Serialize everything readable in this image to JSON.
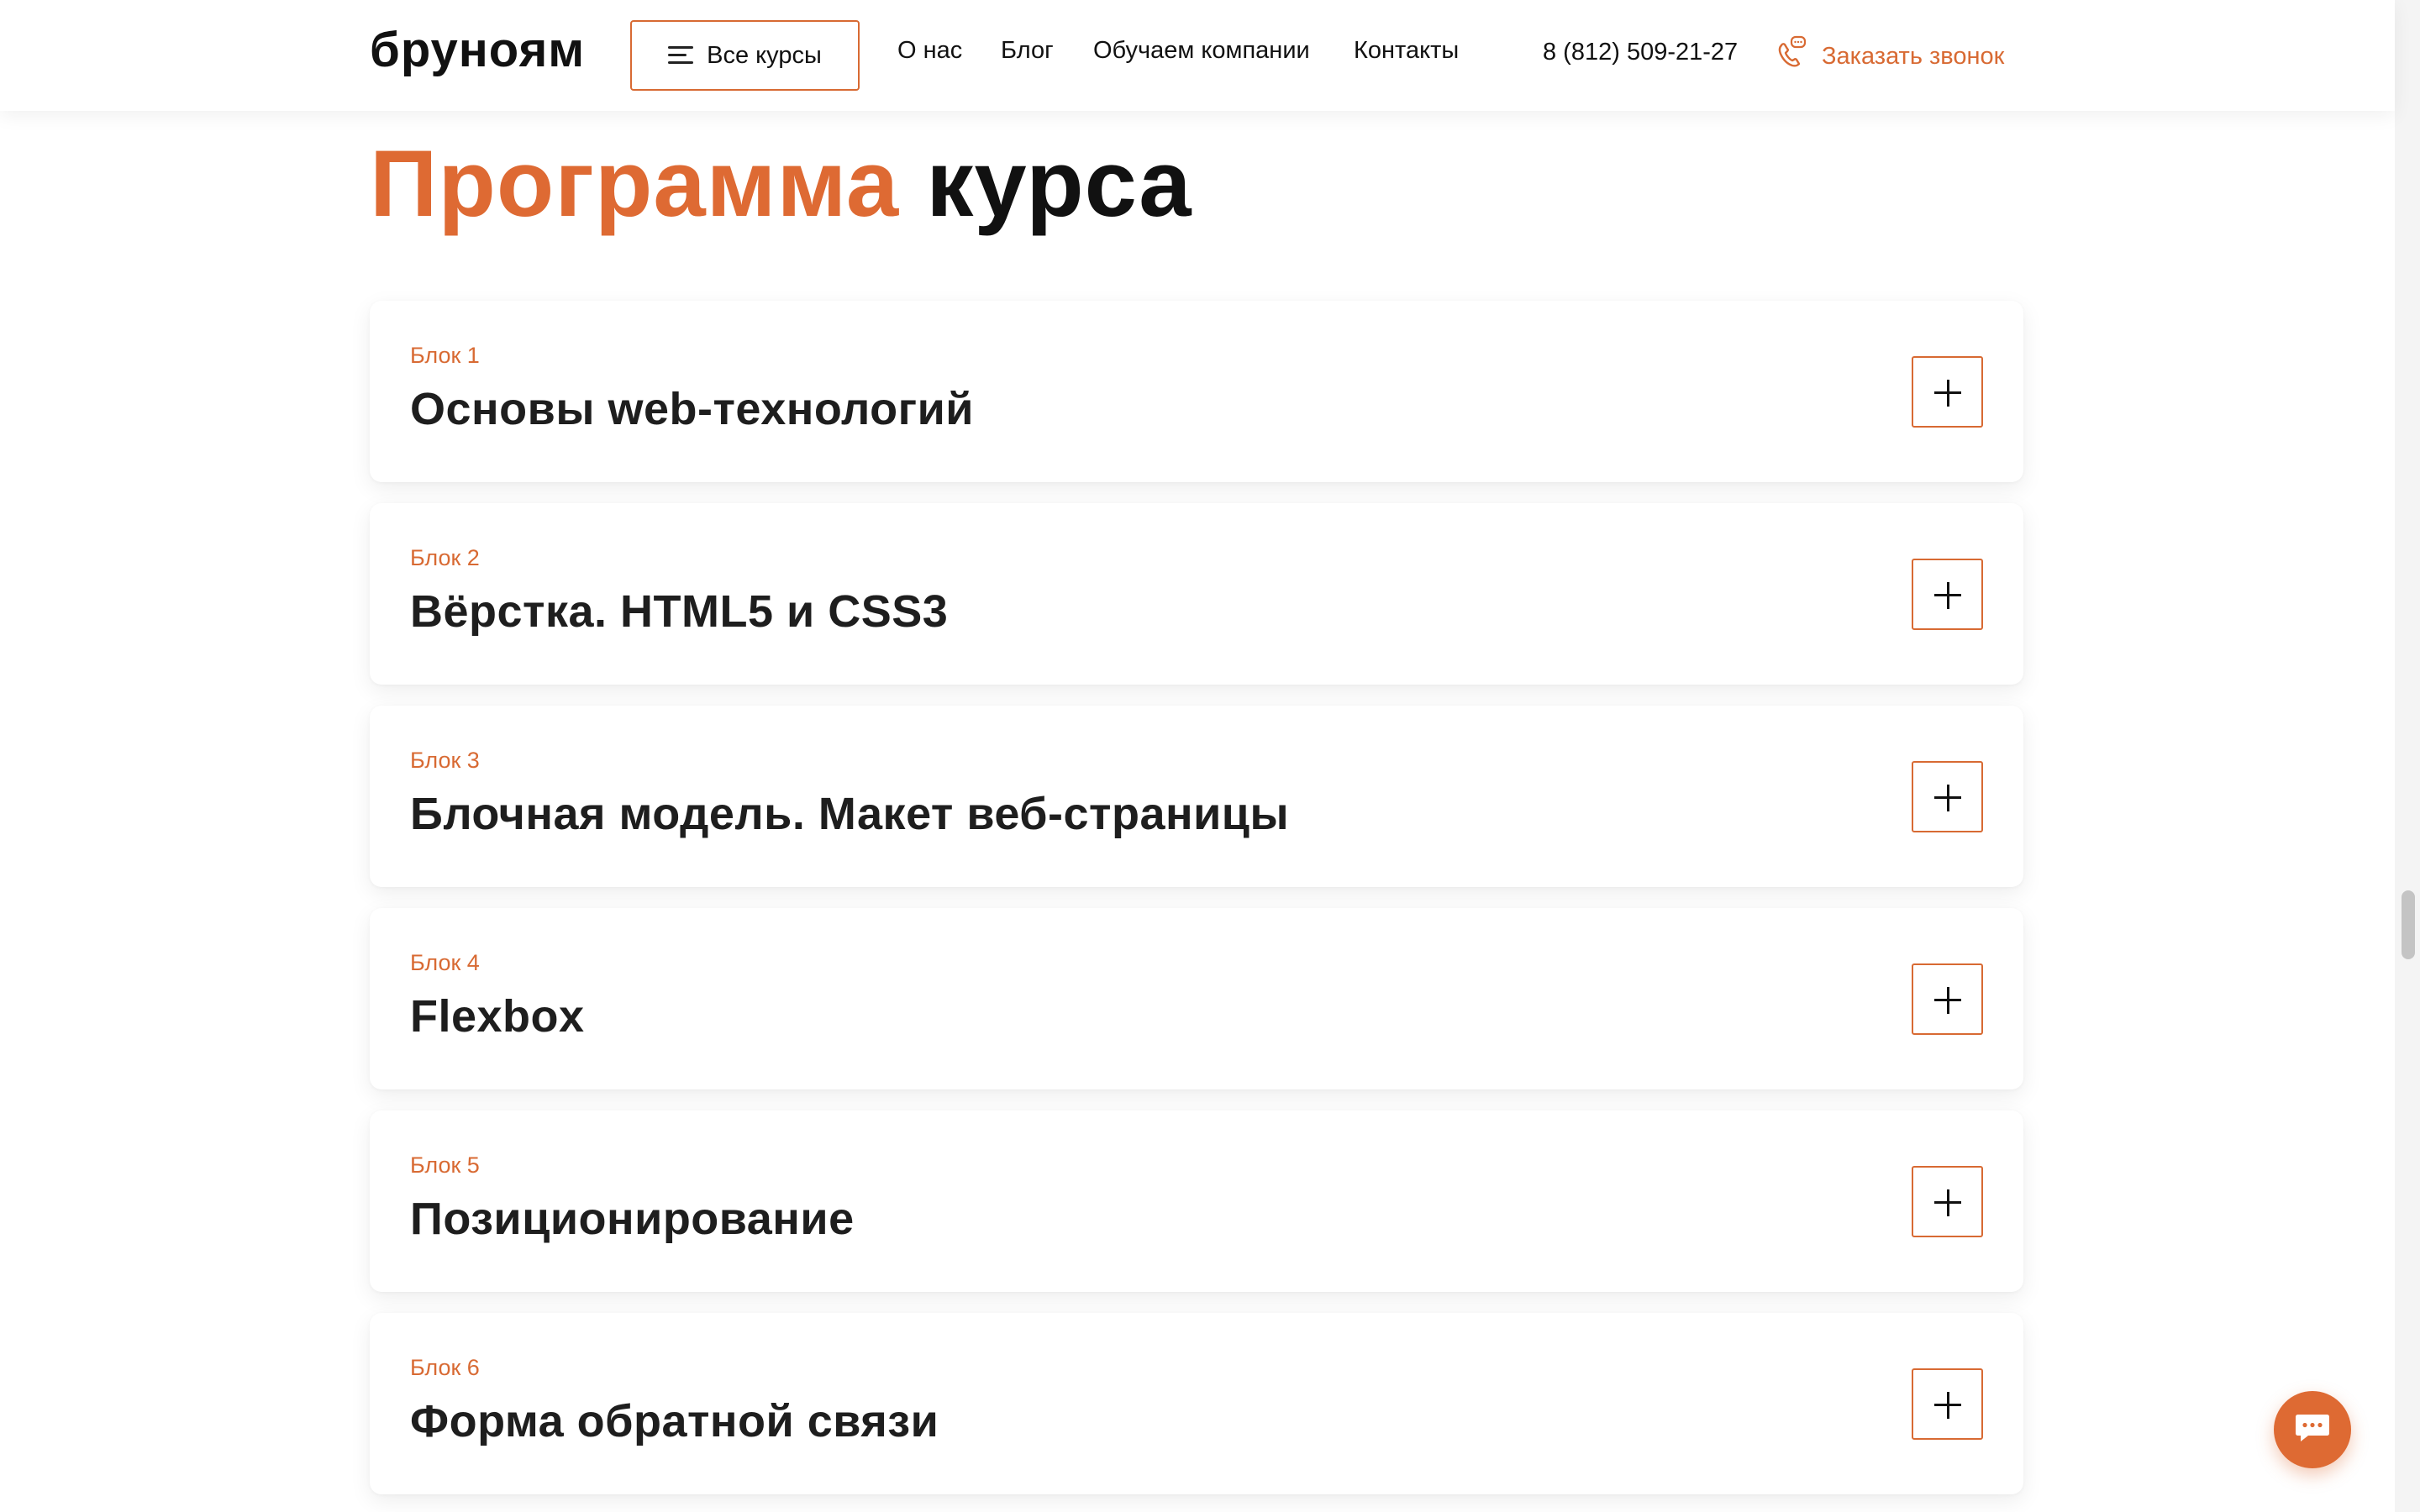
{
  "header": {
    "logo": "бруноям",
    "all_courses_label": "Все курсы",
    "nav": [
      {
        "label": "О нас"
      },
      {
        "label": "Блог"
      },
      {
        "label": "Обучаем компании"
      },
      {
        "label": "Контакты"
      }
    ],
    "phone": "8 (812) 509-21-27",
    "callback_label": "Заказать звонок"
  },
  "section": {
    "title_accent": "Программа",
    "title_rest": "курса"
  },
  "blocks": [
    {
      "number": "Блок 1",
      "title": "Основы web-технологий"
    },
    {
      "number": "Блок 2",
      "title": "Вёрстка. HTML5 и CSS3"
    },
    {
      "number": "Блок 3",
      "title": "Блочная модель. Макет веб-страницы"
    },
    {
      "number": "Блок 4",
      "title": "Flexbox"
    },
    {
      "number": "Блок 5",
      "title": "Позиционирование"
    },
    {
      "number": "Блок 6",
      "title": "Форма обратной связи"
    }
  ],
  "colors": {
    "accent": "#de6a33",
    "text": "#111111",
    "background": "#ffffff"
  },
  "icons": {
    "menu": "hamburger-icon",
    "callback": "phone-icon",
    "expand": "plus-icon",
    "chat": "chat-bubble-icon"
  }
}
